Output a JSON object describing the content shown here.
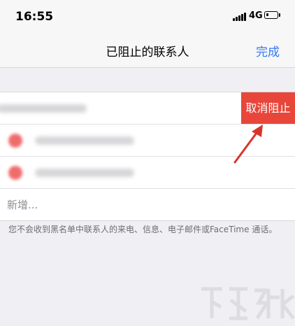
{
  "status_bar": {
    "time": "16:55",
    "network": "4G"
  },
  "nav_bar": {
    "title": "已阻止的联系人",
    "done_label": "完成"
  },
  "contacts": [
    {
      "blurred": true
    },
    {
      "blurred": true
    },
    {
      "blurred": true
    }
  ],
  "unblock_label": "取消阻止",
  "add_new_label": "新增...",
  "footer_note": "您不会收到黑名单中联系人的来电、信息、电子邮件或FaceTime 通话。",
  "colors": {
    "accent_blue": "#3478f6",
    "unblock_red": "#e8463b",
    "minus_red": "#f06c6c",
    "annotation_arrow": "#d9342b"
  },
  "icons": [
    "signal-icon",
    "battery-icon",
    "minus-circle-icon",
    "arrow-annotation-icon"
  ]
}
